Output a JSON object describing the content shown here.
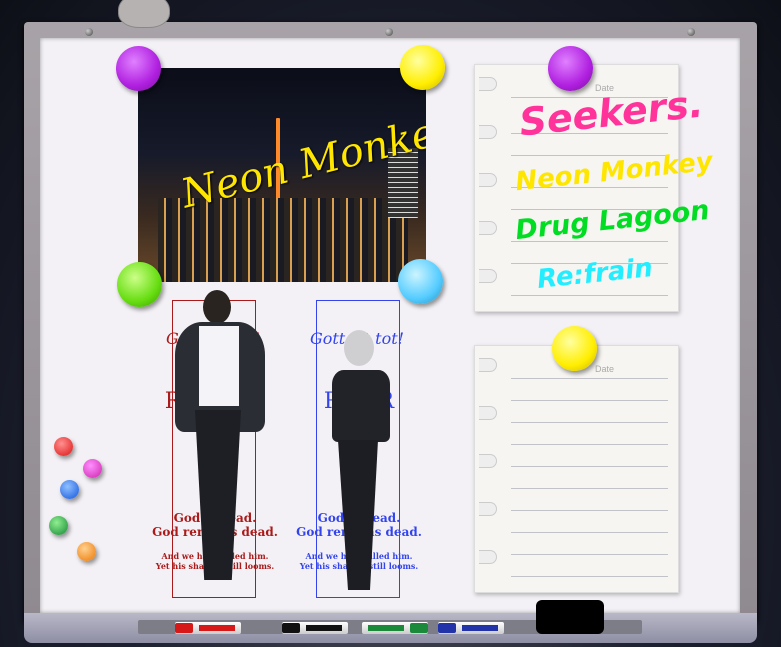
{
  "board": {
    "colors": {
      "frame": "#9d98a0",
      "surface": "#f3f1f5"
    }
  },
  "photo": {
    "title": "Neon Monkey",
    "title_color": "#ffe600"
  },
  "menu_note": {
    "date_label": "Date",
    "items": [
      {
        "label": "Seekers.",
        "color": "#ff3399"
      },
      {
        "label": "Neon Monkey",
        "color": "#ffe600"
      },
      {
        "label": "Drug Lagoon",
        "color": "#00dd22"
      },
      {
        "label": "Re:frain",
        "color": "#22eeff"
      }
    ]
  },
  "blank_note": {
    "date_label": "Date"
  },
  "posters": [
    {
      "script": "Gott ist tot!",
      "heading": "R",
      "lines": [
        "God is dead.",
        "God remains dead."
      ],
      "sub": [
        "And we have killed him.",
        "Yet his shadow still looms."
      ],
      "color": "#aa1a1a"
    },
    {
      "script": "Gott ist tot!",
      "heading": "R   ER",
      "lines": [
        "God is dead.",
        "God remains dead."
      ],
      "sub": [
        "And we have killed him.",
        "Yet his shadow still looms."
      ],
      "color": "#3344ee"
    }
  ],
  "pins": {
    "purple": "#b020e0",
    "yellow": "#ffee00",
    "green": "#66dd11",
    "blue": "#55ccff"
  },
  "markers": [
    {
      "color": "red",
      "hex": "#d61818"
    },
    {
      "color": "black",
      "hex": "#111111"
    },
    {
      "color": "green",
      "hex": "#1a8a3a"
    },
    {
      "color": "blue",
      "hex": "#2233aa"
    }
  ],
  "mascot": "cat-icon"
}
